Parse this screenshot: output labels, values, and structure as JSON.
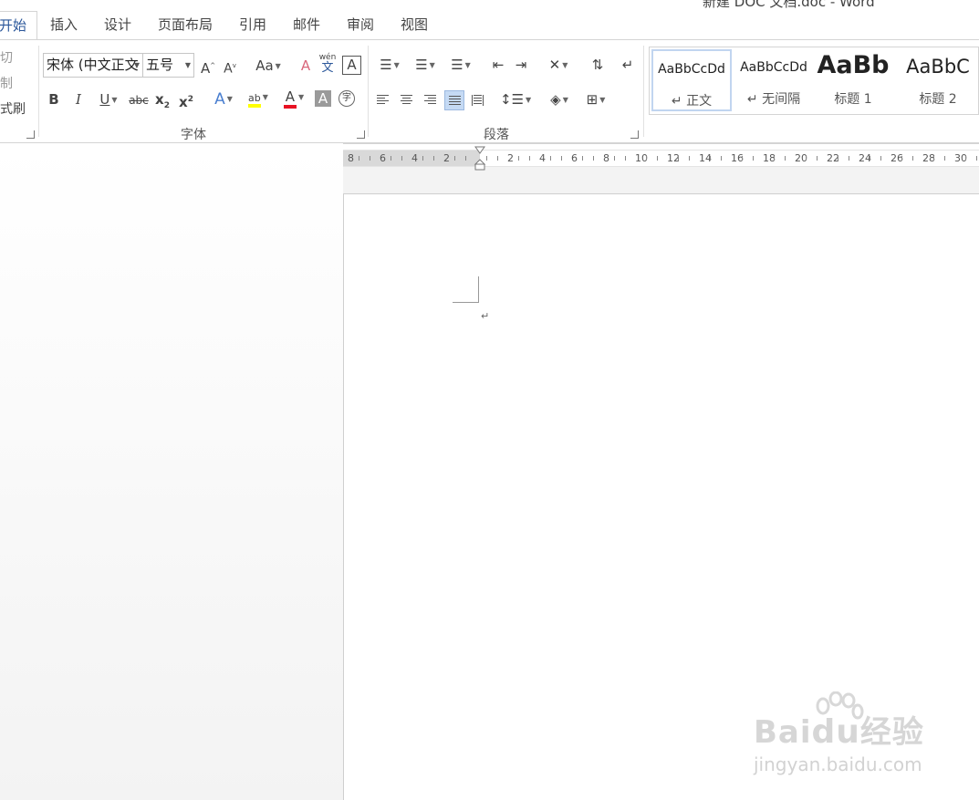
{
  "window": {
    "title": "新建 DOC 文档.doc - Word"
  },
  "tabs": [
    "开始",
    "插入",
    "设计",
    "页面布局",
    "引用",
    "邮件",
    "审阅",
    "视图"
  ],
  "clipboard": {
    "cut": "切",
    "copy": "制",
    "format_painter": "式刷"
  },
  "font": {
    "name": "宋体 (中文正文",
    "size": "五号",
    "group_label": "字体",
    "grow": "A",
    "shrink": "A",
    "change_case": "Aa",
    "clear_format": "A",
    "phonetic_top": "wén",
    "phonetic_bottom": "文",
    "char_border": "A",
    "bold": "B",
    "italic": "I",
    "underline": "U",
    "strike": "abc",
    "subscript": "x",
    "subscript_sub": "2",
    "superscript": "x",
    "superscript_sup": "2",
    "text_effect": "A",
    "highlight": "ab",
    "font_color": "A",
    "char_shading": "A",
    "enclose": "字"
  },
  "colors": {
    "accent": "#2b579a",
    "highlight": "#ffff00",
    "font_color": "#e81123",
    "text_effect": "#4a7fd0",
    "selection": "#c5daf4"
  },
  "paragraph": {
    "group_label": "段落"
  },
  "styles": [
    {
      "sample": "AaBbCcDd",
      "name": "↵ 正文"
    },
    {
      "sample": "AaBbCcDd",
      "name": "↵ 无间隔"
    },
    {
      "sample": "AaBb",
      "name": "标题 1"
    },
    {
      "sample": "AaBbC",
      "name": "标题 2"
    }
  ],
  "ruler": {
    "labels": [
      "8",
      "6",
      "4",
      "2",
      "",
      "2",
      "4",
      "6",
      "8",
      "10",
      "12",
      "14",
      "16",
      "18",
      "20",
      "22",
      "24",
      "26",
      "28",
      "30"
    ]
  },
  "document": {
    "paragraph_mark": "↵"
  },
  "watermark": {
    "brand": "Bai",
    "brand2": "du",
    "brand3": "经验",
    "url": "jingyan.baidu.com"
  }
}
